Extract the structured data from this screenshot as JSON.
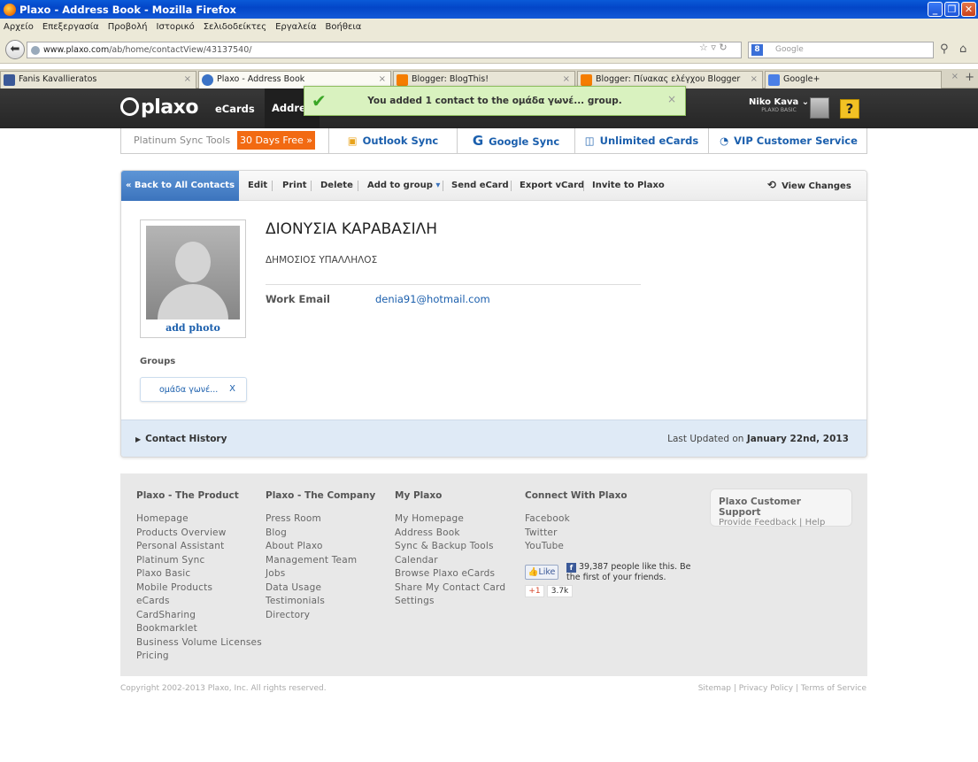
{
  "window": {
    "title": "Plaxo - Address Book - Mozilla Firefox"
  },
  "menu": [
    "Αρχείο",
    "Επεξεργασία",
    "Προβολή",
    "Ιστορικό",
    "Σελιδοδείκτες",
    "Εργαλεία",
    "Βοήθεια"
  ],
  "nav": {
    "url_domain": "www.plaxo.com",
    "url_path": "/ab/home/contactView/43137540/",
    "search_placeholder": "Google"
  },
  "tabs": [
    {
      "label": "Fanis Kavallieratos",
      "icon": "facebook-icon",
      "color": "#3b5998"
    },
    {
      "label": "Plaxo - Address Book",
      "icon": "plaxo-icon",
      "color": "#3b73c6"
    },
    {
      "label": "Blogger: BlogThis!",
      "icon": "blogger-icon",
      "color": "#f57d00"
    },
    {
      "label": "Blogger: Πίνακας ελέγχου Blogger",
      "icon": "blogger-icon",
      "color": "#f57d00"
    },
    {
      "label": "Google+",
      "icon": "google-icon",
      "color": "#4a7fe6"
    }
  ],
  "plaxo": {
    "logo": "plaxo",
    "nav_ecards": "eCards",
    "nav_address": "Addres",
    "user_name": "Niko Kava",
    "user_plan": "PLAXO BASIC",
    "help": "?"
  },
  "notification": {
    "message": "You added 1 contact to the ομάδα γωνέ... group.",
    "close": "×"
  },
  "promo": {
    "platinum": "Platinum Sync Tools",
    "free_btn": "30 Days Free »",
    "outlook": "Outlook Sync",
    "google": "Google Sync",
    "ecards": "Unlimited eCards",
    "vip": "VIP Customer Service"
  },
  "toolbar": {
    "back": "« Back to All Contacts",
    "edit": "Edit",
    "print": "Print",
    "delete": "Delete",
    "add_group": "Add to group",
    "send_ecard": "Send eCard",
    "export": "Export vCard",
    "invite": "Invite to Plaxo",
    "view_changes": "View Changes"
  },
  "contact": {
    "name": "ΔΙΟΝΥΣΙΑ ΚΑΡΑΒΑΣΙΛΗ",
    "job_title": "ΔΗΜΟΣΙΟΣ ΥΠΑΛΛΗΛΟΣ",
    "add_photo": "add photo",
    "email_label": "Work Email",
    "email": "denia91@hotmail.com",
    "groups_label": "Groups",
    "group_name": "ομάδα γωνέ...",
    "group_remove": "X",
    "history": "Contact History",
    "last_updated_prefix": "Last Updated on",
    "last_updated": "January 22nd, 2013"
  },
  "footer": {
    "col1": {
      "title": "Plaxo - The Product",
      "items": [
        "Homepage",
        "Products Overview",
        "Personal Assistant",
        "Platinum Sync",
        "Plaxo Basic",
        "Mobile Products",
        "eCards",
        "CardSharing",
        "Bookmarklet",
        "Business Volume Licenses",
        "Pricing"
      ]
    },
    "col2": {
      "title": "Plaxo - The Company",
      "items": [
        "Press Room",
        "Blog",
        "About Plaxo",
        "Management Team",
        "Jobs",
        "Data Usage",
        "Testimonials",
        "Directory"
      ]
    },
    "col3": {
      "title": "My Plaxo",
      "items": [
        "My Homepage",
        "Address Book",
        "Sync & Backup Tools",
        "Calendar",
        "Browse Plaxo eCards",
        "Share My Contact Card",
        "Settings"
      ]
    },
    "col4": {
      "title": "Connect With Plaxo",
      "items": [
        "Facebook",
        "Twitter",
        "YouTube"
      ]
    },
    "support_title": "Plaxo Customer Support",
    "support_links": "Provide Feedback | Help",
    "like_btn": "Like",
    "like_text": "39,387 people like this. Be the first of your friends.",
    "gplus": "+1",
    "gplus_count": "3.7k",
    "copyright": "Copyright 2002-2013 Plaxo, Inc. All rights reserved.",
    "links": "Sitemap | Privacy Policy | Terms of Service"
  }
}
